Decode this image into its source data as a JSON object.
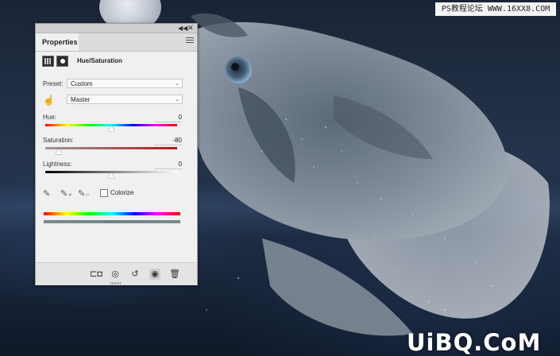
{
  "watermark": {
    "top_text": "PS教程论坛 WWW.16XX8.COM",
    "bottom_text": "UiBQ.CoM"
  },
  "panel": {
    "tab_label": "Properties",
    "title": "Hue/Saturation",
    "preset_label": "Preset:",
    "preset_value": "Custom",
    "channel_value": "Master",
    "hue_label": "Hue:",
    "hue_value": "0",
    "hue_fraction": 0.5,
    "saturation_label": "Saturation:",
    "saturation_value": "-80",
    "saturation_fraction": 0.1,
    "lightness_label": "Lightness:",
    "lightness_value": "0",
    "lightness_fraction": 0.5,
    "colorize_label": "Colorize",
    "colorize_checked": false
  },
  "icons": {
    "collapse": "double-chevron-left-icon",
    "close": "close-icon",
    "menu": "panel-menu-icon",
    "layer_adjust": "adjustment-layer-icon",
    "mask": "layer-mask-icon",
    "hand": "targeted-adjustment-hand-icon",
    "eyedropper": "eyedropper-icon",
    "eyedropper_add": "eyedropper-plus-icon",
    "eyedropper_subtract": "eyedropper-minus-icon",
    "clip": "clip-to-layer-icon",
    "view_previous": "view-previous-state-icon",
    "reset": "reset-icon",
    "visibility": "eye-icon",
    "trash": "trash-icon"
  }
}
